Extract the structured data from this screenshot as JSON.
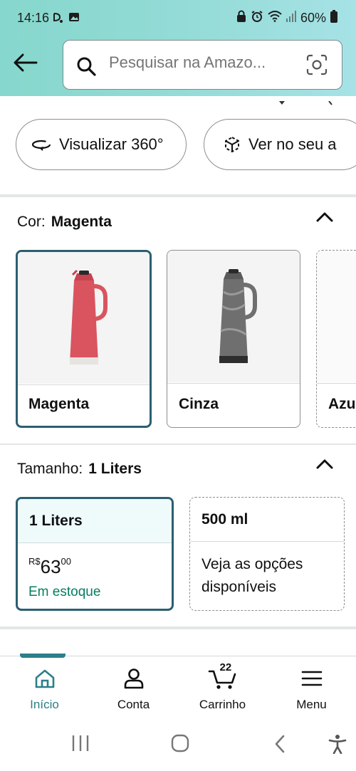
{
  "status_bar": {
    "time": "14:16",
    "battery": "60%"
  },
  "header": {
    "search_placeholder": "Pesquisar na Amazo..."
  },
  "view_options": {
    "view_360": "Visualizar 360°",
    "view_ar": "Ver no seu a"
  },
  "color_section": {
    "label": "Cor:",
    "selected": "Magenta",
    "options": [
      {
        "name": "Magenta",
        "color": "#d9545f"
      },
      {
        "name": "Cinza",
        "color": "#6f6f6f"
      },
      {
        "name": "Azu"
      }
    ]
  },
  "size_section": {
    "label": "Tamanho:",
    "selected": "1 Liters",
    "options": [
      {
        "name": "1 Liters",
        "currency": "R$",
        "price_int": "63",
        "price_cents": "00",
        "stock": "Em estoque"
      },
      {
        "name": "500 ml",
        "description": "Veja as opções disponíveis"
      }
    ]
  },
  "bottom_nav": {
    "items": [
      {
        "label": "Início",
        "icon": "home-icon"
      },
      {
        "label": "Conta",
        "icon": "person-icon"
      },
      {
        "label": "Carrinho",
        "icon": "cart-icon",
        "count": "22"
      },
      {
        "label": "Menu",
        "icon": "menu-icon"
      }
    ]
  },
  "colors": {
    "accent": "#2b7f8a",
    "selected_border": "#2b5f70",
    "stock_green": "#067d62"
  }
}
